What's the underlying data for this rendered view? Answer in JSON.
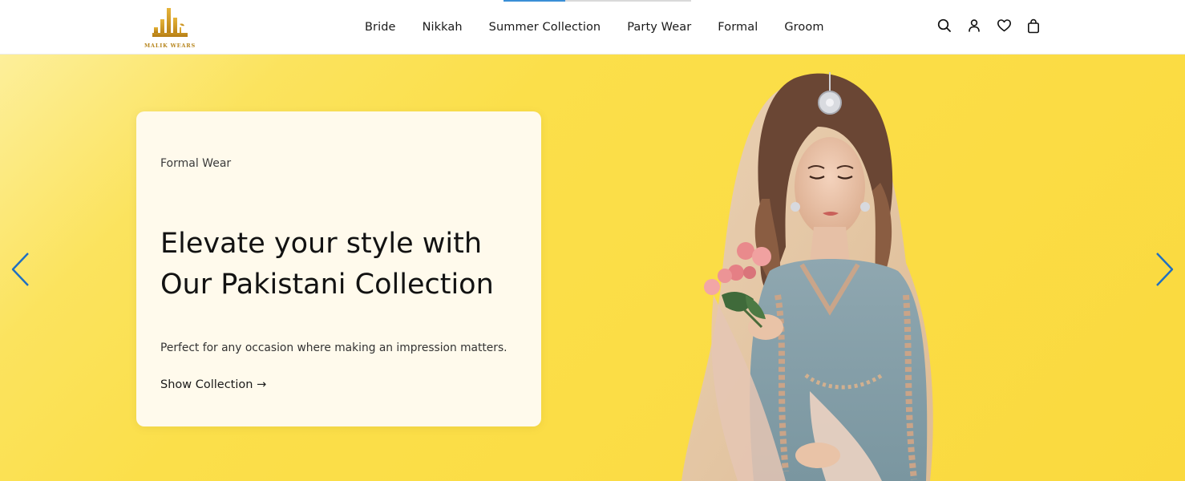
{
  "brand": {
    "logo_text": "MALIK WEARS",
    "accent": "#c8921f"
  },
  "slider": {
    "progress": 0.33
  },
  "nav": {
    "items": [
      {
        "label": "Bride"
      },
      {
        "label": "Nikkah"
      },
      {
        "label": "Summer Collection"
      },
      {
        "label": "Party Wear"
      },
      {
        "label": "Formal"
      },
      {
        "label": "Groom"
      }
    ]
  },
  "header_icons": [
    "search-icon",
    "account-icon",
    "wishlist-heart-icon",
    "cart-bag-icon"
  ],
  "hero": {
    "eyebrow": "Formal Wear",
    "title_line1": "Elevate your style with",
    "title_line2": "Our Pakistani Collection",
    "description": "Perfect for any occasion where making an impression matters.",
    "cta": "Show Collection →",
    "background": "#fbdc44",
    "arrow_color": "#1f6fc2"
  }
}
